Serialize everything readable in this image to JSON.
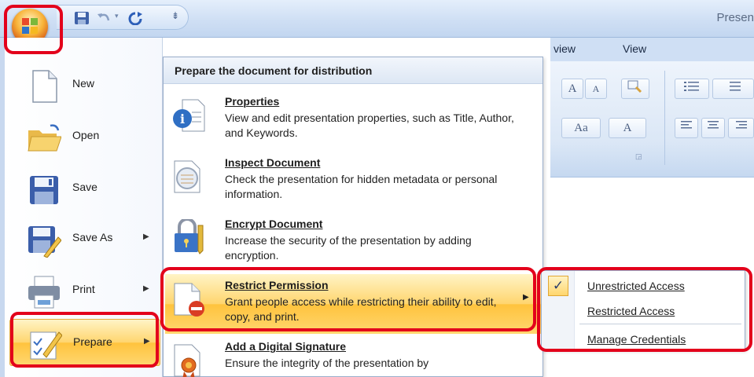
{
  "app": {
    "title": "Presen"
  },
  "ribbon": {
    "tabs": [
      "view",
      "View"
    ],
    "font_grow": "A",
    "font_shrink": "A",
    "aa_label": "Aa",
    "font_color": "A"
  },
  "menu": {
    "items": [
      {
        "label": "New",
        "has_arrow": false
      },
      {
        "label": "Open",
        "has_arrow": false
      },
      {
        "label": "Save",
        "has_arrow": false
      },
      {
        "label": "Save As",
        "has_arrow": true
      },
      {
        "label": "Print",
        "has_arrow": true
      },
      {
        "label": "Prepare",
        "has_arrow": true,
        "selected": true
      }
    ]
  },
  "submenu": {
    "heading": "Prepare the document for distribution",
    "items": [
      {
        "title": "Properties",
        "desc": "View and edit presentation properties, such as Title, Author, and Keywords."
      },
      {
        "title": "Inspect Document",
        "desc": "Check the presentation for hidden metadata or personal information."
      },
      {
        "title": "Encrypt Document",
        "desc": "Increase the security of the presentation by adding encryption."
      },
      {
        "title": "Restrict Permission",
        "desc": "Grant people access while restricting their ability to edit, copy, and print.",
        "selected": true
      },
      {
        "title": "Add a Digital Signature",
        "desc": "Ensure the integrity of the presentation by"
      }
    ]
  },
  "flyout": {
    "items": [
      {
        "label": "Unrestricted Access",
        "checked": true
      },
      {
        "label": "Restricted Access",
        "checked": false
      },
      {
        "label": "Manage Credentials",
        "checked": false
      }
    ],
    "check_glyph": "✓"
  },
  "colors": {
    "highlight": "#e3001b",
    "selection": "#ffd56e"
  }
}
